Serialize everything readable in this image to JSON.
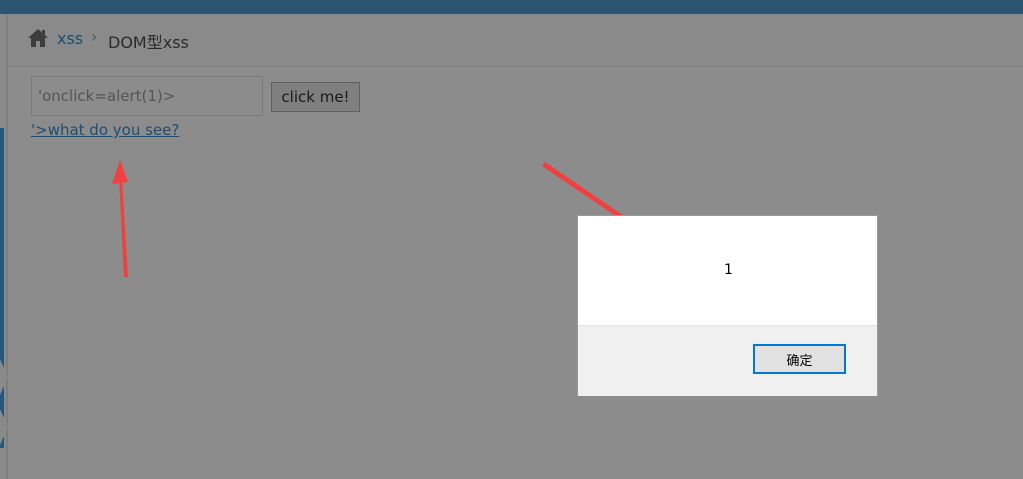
{
  "breadcrumb": {
    "home_icon": "home-icon",
    "link_label": "xss",
    "separator": "›",
    "current_label": "DOM型xss"
  },
  "form": {
    "input_value": "'onclick=alert(1)>",
    "button_label": "click me!"
  },
  "result": {
    "link_text": "'>what do you see?"
  },
  "alert_dialog": {
    "message": "1",
    "ok_label": "确定"
  },
  "colors": {
    "topbar": "#2c5574",
    "link": "#1f4d70",
    "annotation_arrow": "#f04040",
    "dialog_button_border": "#0078d7"
  }
}
